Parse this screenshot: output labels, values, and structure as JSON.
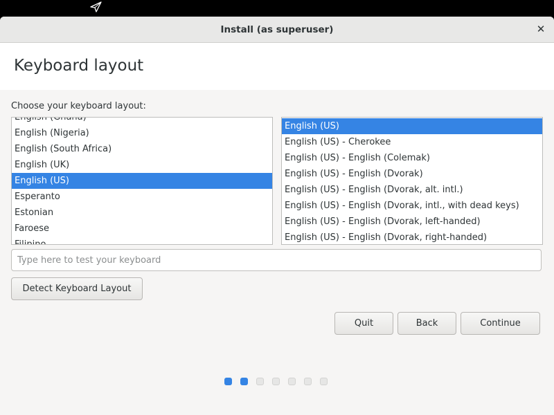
{
  "window": {
    "title": "Install (as superuser)"
  },
  "page": {
    "heading": "Keyboard layout",
    "prompt": "Choose your keyboard layout:"
  },
  "layouts": [
    {
      "label": "English (Ghana)",
      "selected": false
    },
    {
      "label": "English (Nigeria)",
      "selected": false
    },
    {
      "label": "English (South Africa)",
      "selected": false
    },
    {
      "label": "English (UK)",
      "selected": false
    },
    {
      "label": "English (US)",
      "selected": true
    },
    {
      "label": "Esperanto",
      "selected": false
    },
    {
      "label": "Estonian",
      "selected": false
    },
    {
      "label": "Faroese",
      "selected": false
    },
    {
      "label": "Filipino",
      "selected": false
    }
  ],
  "variants": [
    {
      "label": "English (US)",
      "selected": true
    },
    {
      "label": "English (US) - Cherokee",
      "selected": false
    },
    {
      "label": "English (US) - English (Colemak)",
      "selected": false
    },
    {
      "label": "English (US) - English (Dvorak)",
      "selected": false
    },
    {
      "label": "English (US) - English (Dvorak, alt. intl.)",
      "selected": false
    },
    {
      "label": "English (US) - English (Dvorak, intl., with dead keys)",
      "selected": false
    },
    {
      "label": "English (US) - English (Dvorak, left-handed)",
      "selected": false
    },
    {
      "label": "English (US) - English (Dvorak, right-handed)",
      "selected": false
    }
  ],
  "test_input": {
    "placeholder": "Type here to test your keyboard",
    "value": ""
  },
  "buttons": {
    "detect": "Detect Keyboard Layout",
    "quit": "Quit",
    "back": "Back",
    "continue": "Continue"
  },
  "progress": {
    "total_steps": 7,
    "current_step": 2
  },
  "colors": {
    "accent": "#3584e4",
    "background": "#f6f5f4"
  },
  "icons": {
    "close": "close-icon",
    "cursor": "mouse-pointer-icon"
  }
}
